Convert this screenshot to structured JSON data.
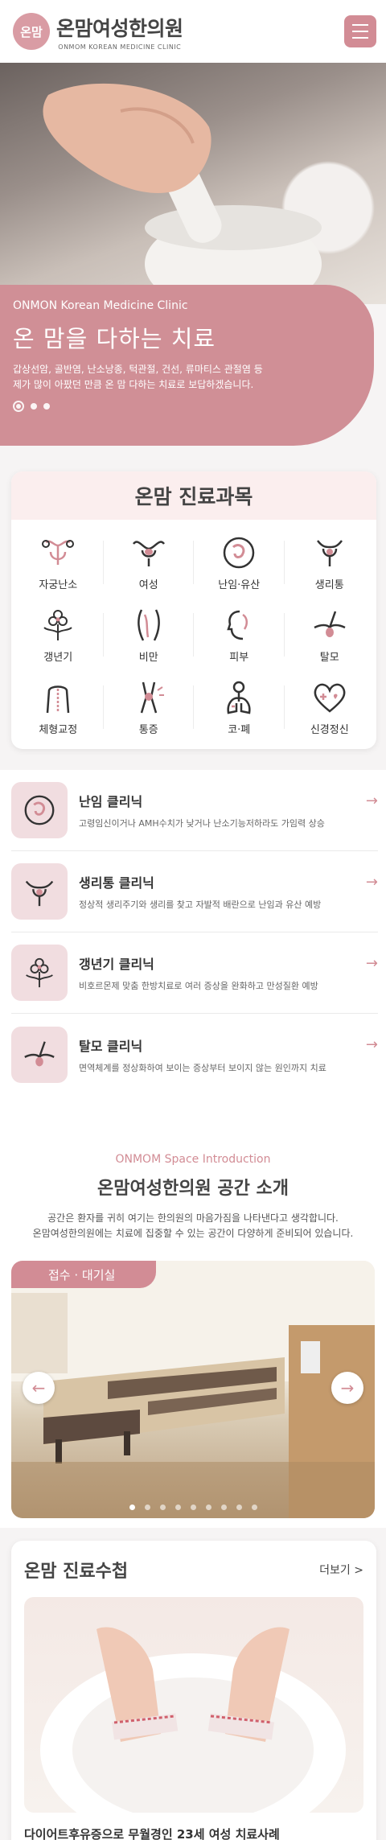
{
  "header": {
    "logo_mark": "온맘",
    "brand_name": "온맘여성한의원",
    "brand_sub": "ONMOM KOREAN MEDICINE CLINIC"
  },
  "hero": {
    "kicker": "ONMON Korean Medicine Clinic",
    "title": "온 맘을 다하는 치료",
    "description": "갑상선암, 골반염, 난소낭종, 턱관절, 건선, 류마티스 관절염 등 제가 많이 아팠던 만큼 온 맘 다하는 치료로 보답하겠습니다.",
    "slide_count": 3,
    "active_slide": 0
  },
  "departments": {
    "title": "온맘 진료과목",
    "items": [
      {
        "label": "자궁난소",
        "icon": "uterus-ovary-icon"
      },
      {
        "label": "여성",
        "icon": "female-reproductive-icon"
      },
      {
        "label": "난임·유산",
        "icon": "fetus-icon"
      },
      {
        "label": "생리통",
        "icon": "menstrual-pain-icon"
      },
      {
        "label": "갱년기",
        "icon": "menopause-flower-icon"
      },
      {
        "label": "비만",
        "icon": "obesity-body-icon"
      },
      {
        "label": "피부",
        "icon": "skin-face-icon"
      },
      {
        "label": "탈모",
        "icon": "hair-follicle-icon"
      },
      {
        "label": "체형교정",
        "icon": "posture-back-icon"
      },
      {
        "label": "통증",
        "icon": "joint-pain-icon"
      },
      {
        "label": "코·폐",
        "icon": "lungs-icon"
      },
      {
        "label": "신경정신",
        "icon": "heart-cross-icon"
      }
    ]
  },
  "clinics": [
    {
      "title": "난임 클리닉",
      "desc": "고령임신이거나 AMH수치가 낮거나 난소기능저하라도 가임력 상승",
      "icon": "fetus-icon"
    },
    {
      "title": "생리통 클리닉",
      "desc": "정상적 생리주기와 생리를 찾고 자발적 배란으로 난임과 유산 예방",
      "icon": "uterus-icon"
    },
    {
      "title": "갱년기 클리닉",
      "desc": "비호르몬제 맞춤 한방치료로 여러 증상을 완화하고 만성질환 예방",
      "icon": "flower-icon"
    },
    {
      "title": "탈모 클리닉",
      "desc": "면역체계를 정상화하여 보이는 증상부터 보이지 않는 원인까지 치료",
      "icon": "hair-icon"
    }
  ],
  "space": {
    "en_title": "ONMOM Space Introduction",
    "title": "온맘여성한의원 공간 소개",
    "text_line1": "공간은 환자를 귀히 여기는 한의원의 마음가짐을 나타낸다고 생각합니다.",
    "text_line2": "온맘여성한의원에는 치료에 집중할 수 있는 공간이 다양하게 준비되어 있습니다.",
    "tag": "접수 · 대기실",
    "slide_count": 9,
    "active_slide": 0
  },
  "reviews": {
    "title": "온맘 진료수첩",
    "more": "더보기 >",
    "caption": "다이어트후유증으로 무월경인 23세 여성 치료사례"
  },
  "colors": {
    "accent": "#d28c95",
    "accent_light": "#f1dde0",
    "panel_tint": "#fbeeee"
  }
}
